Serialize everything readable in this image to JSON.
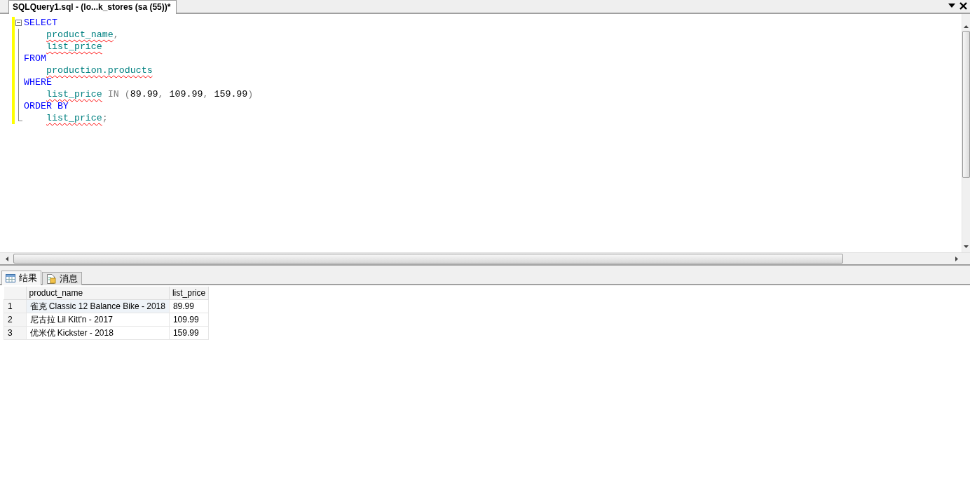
{
  "document_tab": {
    "title": "SQLQuery1.sql - (lo...k_stores (sa (55))*",
    "selected": true
  },
  "editor": {
    "clauses": [
      {
        "tokens": [
          {
            "text": "SELECT",
            "kind": "keyword"
          }
        ],
        "children": [
          {
            "tokens": [
              {
                "text": "product_name",
                "kind": "identifier"
              },
              {
                "text": ",",
                "kind": "operator"
              }
            ]
          },
          {
            "tokens": [
              {
                "text": "list_price",
                "kind": "identifier"
              }
            ]
          }
        ]
      },
      {
        "tokens": [
          {
            "text": "FROM",
            "kind": "keyword"
          }
        ],
        "children": [
          {
            "tokens": [
              {
                "text": "production.products",
                "kind": "identifier"
              }
            ]
          }
        ]
      },
      {
        "tokens": [
          {
            "text": "WHERE",
            "kind": "keyword"
          }
        ],
        "children": [
          {
            "tokens": [
              {
                "text": "list_price",
                "kind": "identifier"
              },
              {
                "text": " IN (",
                "kind": "operator"
              },
              {
                "text": "89.99",
                "kind": "number"
              },
              {
                "text": ", ",
                "kind": "operator"
              },
              {
                "text": "109.99",
                "kind": "number"
              },
              {
                "text": ", ",
                "kind": "operator"
              },
              {
                "text": "159.99",
                "kind": "number"
              },
              {
                "text": ")",
                "kind": "operator"
              }
            ]
          }
        ]
      },
      {
        "tokens": [
          {
            "text": "ORDER BY",
            "kind": "keyword"
          }
        ],
        "children": [
          {
            "tokens": [
              {
                "text": "list_price",
                "kind": "identifier"
              },
              {
                "text": ";",
                "kind": "operator"
              }
            ]
          }
        ]
      }
    ]
  },
  "result_tabs": [
    {
      "label": "结果",
      "kind": "grid",
      "selected": true
    },
    {
      "label": "消息",
      "kind": "messages",
      "selected": false
    }
  ],
  "grid": {
    "columns": [
      "product_name",
      "list_price"
    ],
    "rows": [
      {
        "number": "1",
        "cells": [
          "雀克 Classic 12 Balance Bike - 2018",
          "89.99"
        ],
        "focused": true
      },
      {
        "number": "2",
        "cells": [
          "尼古拉 Lil Kitt'n - 2017",
          "109.99"
        ],
        "focused": false
      },
      {
        "number": "3",
        "cells": [
          "优米优 Kickster - 2018",
          "159.99"
        ],
        "focused": false
      }
    ]
  }
}
